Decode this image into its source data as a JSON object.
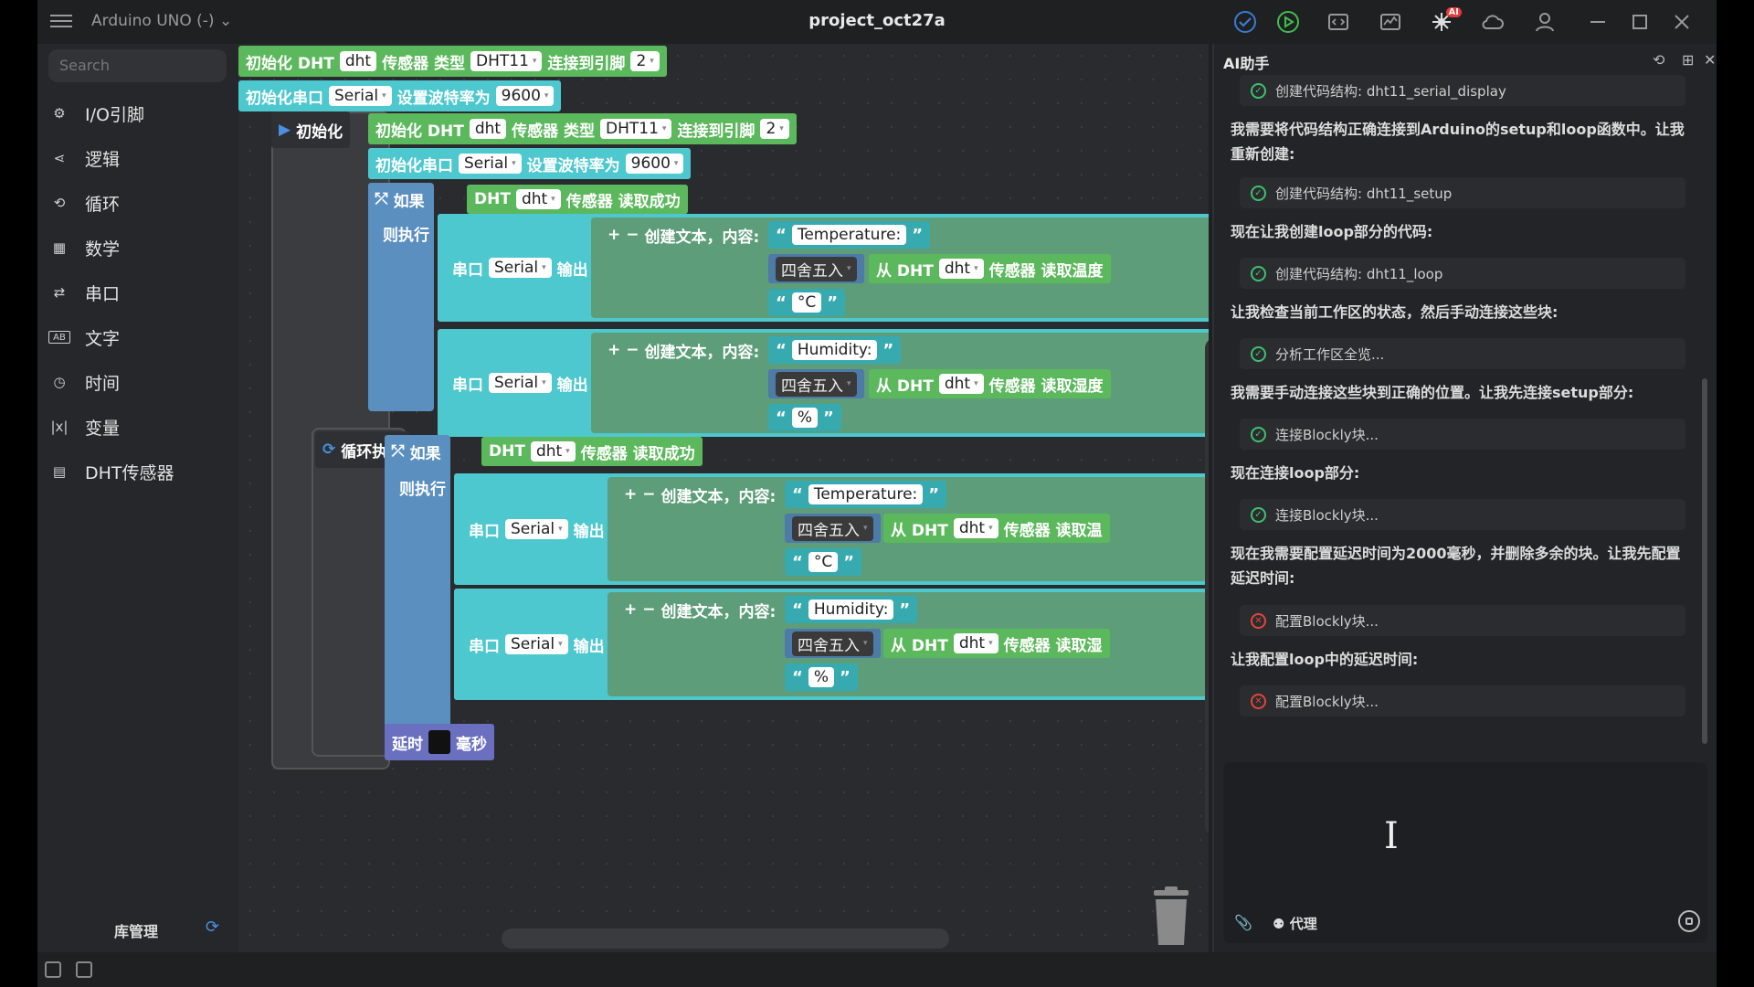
{
  "titlebar": {
    "board": "Arduino UNO (-)",
    "title": "project_oct27a",
    "ai_badge": "AI"
  },
  "sidebar": {
    "search_placeholder": "Search",
    "categories": [
      {
        "label": "I/O引脚",
        "icon": "chip-icon"
      },
      {
        "label": "逻辑",
        "icon": "logic-icon"
      },
      {
        "label": "循环",
        "icon": "loop-icon"
      },
      {
        "label": "数学",
        "icon": "math-icon"
      },
      {
        "label": "串口",
        "icon": "serial-icon"
      },
      {
        "label": "文字",
        "icon": "text-icon"
      },
      {
        "label": "时间",
        "icon": "clock-icon"
      },
      {
        "label": "变量",
        "icon": "variable-icon"
      },
      {
        "label": "DHT传感器",
        "icon": "sensor-icon"
      }
    ],
    "library_manager": "库管理"
  },
  "blocks": {
    "init_dht": "初始化 DHT",
    "dht_var": "dht",
    "sensor_type": "传感器 类型",
    "dht_model": "DHT11",
    "connect_pin": "连接到引脚",
    "pin": "2",
    "init_serial": "初始化串口",
    "serial": "Serial",
    "baud_label": "设置波特率为",
    "baud": "9600",
    "setup_label": "初始化",
    "loop_label": "循环执行",
    "if_label": "如果",
    "dht_prefix": "DHT",
    "read_ok": "传感器 读取成功",
    "then_label": "则执行",
    "serial_port": "串口",
    "output": "输出",
    "create_text": "创建文本，内容:",
    "plus": "+",
    "minus": "−",
    "temperature": "Temperature:",
    "humidity": "Humidity:",
    "round": "四舍五入",
    "from_dht": "从 DHT",
    "read_temp": "传感器 读取温度",
    "read_hum": "传感器 读取湿度",
    "read_cut": "传感器 读取湿",
    "read_cut2": "传感器 读取温",
    "celsius": "°C",
    "percent": "%",
    "delay": "延时",
    "ms": "毫秒",
    "open_quote": "“",
    "close_quote": "”"
  },
  "ai": {
    "title": "AI助手",
    "messages": [
      {
        "kind": "tool",
        "status": "ok",
        "text": "创建代码结构: dht11_serial_display"
      },
      {
        "kind": "note",
        "text": "我需要将代码结构正确连接到Arduino的setup和loop函数中。让我重新创建:"
      },
      {
        "kind": "tool",
        "status": "ok",
        "text": "创建代码结构: dht11_setup"
      },
      {
        "kind": "note",
        "text": "现在让我创建loop部分的代码:"
      },
      {
        "kind": "tool",
        "status": "ok",
        "text": "创建代码结构: dht11_loop"
      },
      {
        "kind": "note",
        "text": "让我检查当前工作区的状态，然后手动连接这些块:"
      },
      {
        "kind": "tool",
        "status": "ok",
        "text": "分析工作区全览..."
      },
      {
        "kind": "note",
        "text": "我需要手动连接这些块到正确的位置。让我先连接setup部分:"
      },
      {
        "kind": "tool",
        "status": "ok",
        "text": "连接Blockly块..."
      },
      {
        "kind": "note",
        "text": "现在连接loop部分:"
      },
      {
        "kind": "tool",
        "status": "ok",
        "text": "连接Blockly块..."
      },
      {
        "kind": "note",
        "text": "现在我需要配置延迟时间为2000毫秒，并删除多余的块。让我先配置延迟时间:"
      },
      {
        "kind": "tool",
        "status": "error",
        "text": "配置Blockly块..."
      },
      {
        "kind": "note",
        "text": "让我配置loop中的延迟时间:"
      },
      {
        "kind": "tool",
        "status": "error",
        "text": "配置Blockly块..."
      }
    ],
    "agent_label": "代理"
  },
  "colors": {
    "block_green": "#5cb85c",
    "block_teal": "#4ec8cf",
    "block_blue": "#5a8fc0",
    "ok": "#3fbf6f",
    "error": "#e0463c"
  }
}
